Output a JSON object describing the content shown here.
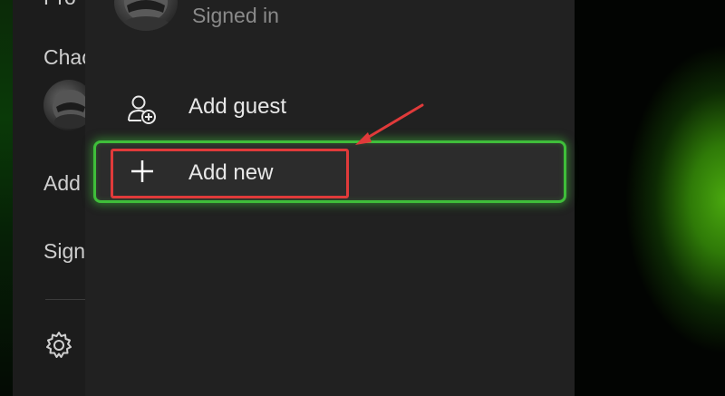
{
  "background": {
    "accent": "#4aa80f"
  },
  "left_panel": {
    "title_partial": "Pro",
    "profile_partial": "Chac",
    "add_partial": "Add",
    "sign_partial": "Sign",
    "settings_icon": "gear-icon"
  },
  "flyout": {
    "status": "Signed in",
    "items": [
      {
        "label": "Add guest",
        "icon": "add-person-icon"
      },
      {
        "label": "Add new",
        "icon": "plus-icon",
        "selected": true
      }
    ]
  },
  "annotation": {
    "highlight_color": "#e03a3a",
    "focus_color": "#3fbe3a"
  }
}
